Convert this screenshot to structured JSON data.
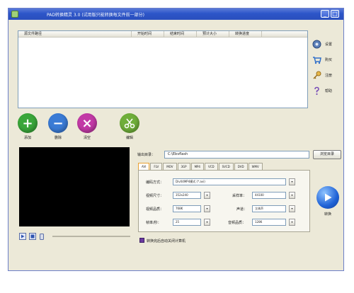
{
  "window": {
    "title": "PAD转换精灵 3.0 (试用版只能转换每文件前一部分)",
    "min_label": "_",
    "max_label": "□",
    "close_label": "×"
  },
  "file_list": {
    "columns": [
      "源文件路径",
      "开始时间",
      "结束时间",
      "预计大小",
      "转换进度"
    ]
  },
  "side_menu": [
    {
      "label": "设置",
      "icon": "gear-icon"
    },
    {
      "label": "购买",
      "icon": "cart-icon"
    },
    {
      "label": "注册",
      "icon": "key-icon"
    },
    {
      "label": "帮助",
      "icon": "question-icon"
    }
  ],
  "toolbar": {
    "add_label": "添加",
    "remove_label": "删除",
    "clear_label": "清空",
    "edit_label": "编辑",
    "add_glyph": "+",
    "remove_glyph": "−",
    "clear_glyph": "×"
  },
  "output": {
    "label": "输出目录：",
    "path": "C:\\Ebvflash",
    "browse_label": "浏览目录"
  },
  "format_tabs": [
    "AVI",
    "FLV",
    "MOV",
    "3GP",
    "MP4",
    "VCD",
    "SVCD",
    "DVD",
    "WMV"
  ],
  "settings": {
    "codec_label": "编码方式：",
    "codec_value": "DivX4MP4模式 (*.avi)",
    "size_label": "视频尺寸：",
    "size_value": "352x240",
    "samplerate_label": "采样率：",
    "samplerate_value": "44100",
    "vquality_label": "视频品质：",
    "vquality_value": "768K",
    "channel_label": "声道：",
    "channel_value": "立体声",
    "fps_label": "帧率/秒：",
    "fps_value": "25",
    "aquality_label": "音频品质：",
    "aquality_value": "128K",
    "dropdown_glyph": "▾"
  },
  "shutdown_label": "转换完后自动关闭计算机",
  "convert_label": "转换",
  "colors": {
    "add": "#3aa63a",
    "remove": "#3a7bd5",
    "clear": "#c23aa6",
    "edit": "#6fae3a",
    "titlebar": "#2c55c8"
  }
}
